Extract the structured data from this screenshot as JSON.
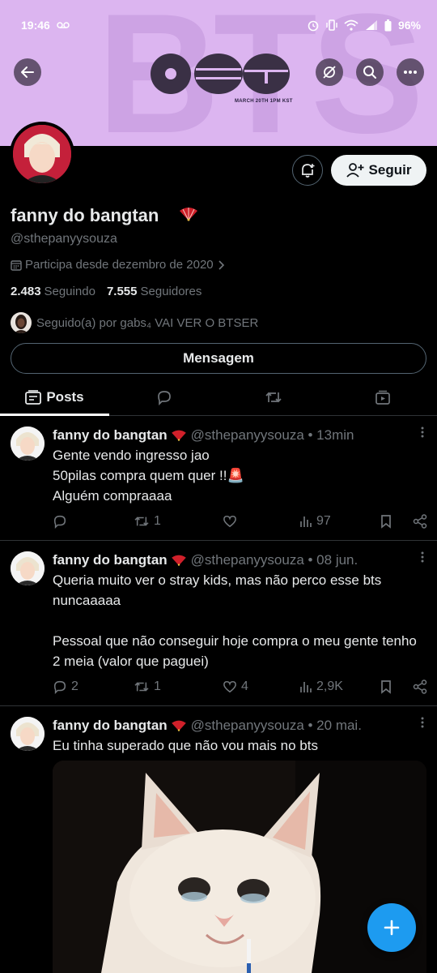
{
  "status_bar": {
    "time": "19:46",
    "carrier_icon": "voicemail-icon",
    "battery": "96%"
  },
  "banner": {
    "watermark": "BTS",
    "logo_date": "MARCH 20TH 1PM KST",
    "bg_color": "#dcb5f0"
  },
  "profile": {
    "display_name": "fanny do bangtan",
    "name_emoji": "fan-icon",
    "handle": "@sthepanyysouza",
    "joined": "Participa desde dezembro de 2020",
    "following_count": "2.483",
    "following_label": "Seguindo",
    "followers_count": "7.555",
    "followers_label": "Seguidores",
    "followed_by": "Seguido(a) por gabs₄ VAI VER O BTSER",
    "follow_label": "Seguir",
    "message_label": "Mensagem"
  },
  "tabs": [
    {
      "label": "Posts",
      "icon": "posts-icon",
      "active": true
    },
    {
      "label": "",
      "icon": "replies-icon"
    },
    {
      "label": "",
      "icon": "reposts-icon"
    },
    {
      "label": "",
      "icon": "media-icon"
    }
  ],
  "posts": [
    {
      "name": "fanny do bangtan",
      "meta": "@sthepanyysouza • 13min",
      "text": "Gente vendo ingresso jao\n50pilas compra quem quer !!🚨\nAlguém compraaaa",
      "replies": "",
      "reposts": "1",
      "likes": "",
      "views": "97"
    },
    {
      "name": "fanny do bangtan",
      "meta": "@sthepanyysouza • 08 jun.",
      "text": "Queria muito ver o stray kids, mas não perco esse bts nuncaaaaa\n\nPessoal que não conseguir hoje compra o meu gente tenho 2 meia (valor que paguei)",
      "replies": "2",
      "reposts": "1",
      "likes": "4",
      "views": "2,9K"
    },
    {
      "name": "fanny do bangtan",
      "meta": "@sthepanyysouza • 20 mai.",
      "text": "Eu tinha superado que não vou mais no bts"
    }
  ],
  "colors": {
    "accent": "#1d9bf0",
    "muted": "#71767b",
    "divider": "#2f3336"
  }
}
